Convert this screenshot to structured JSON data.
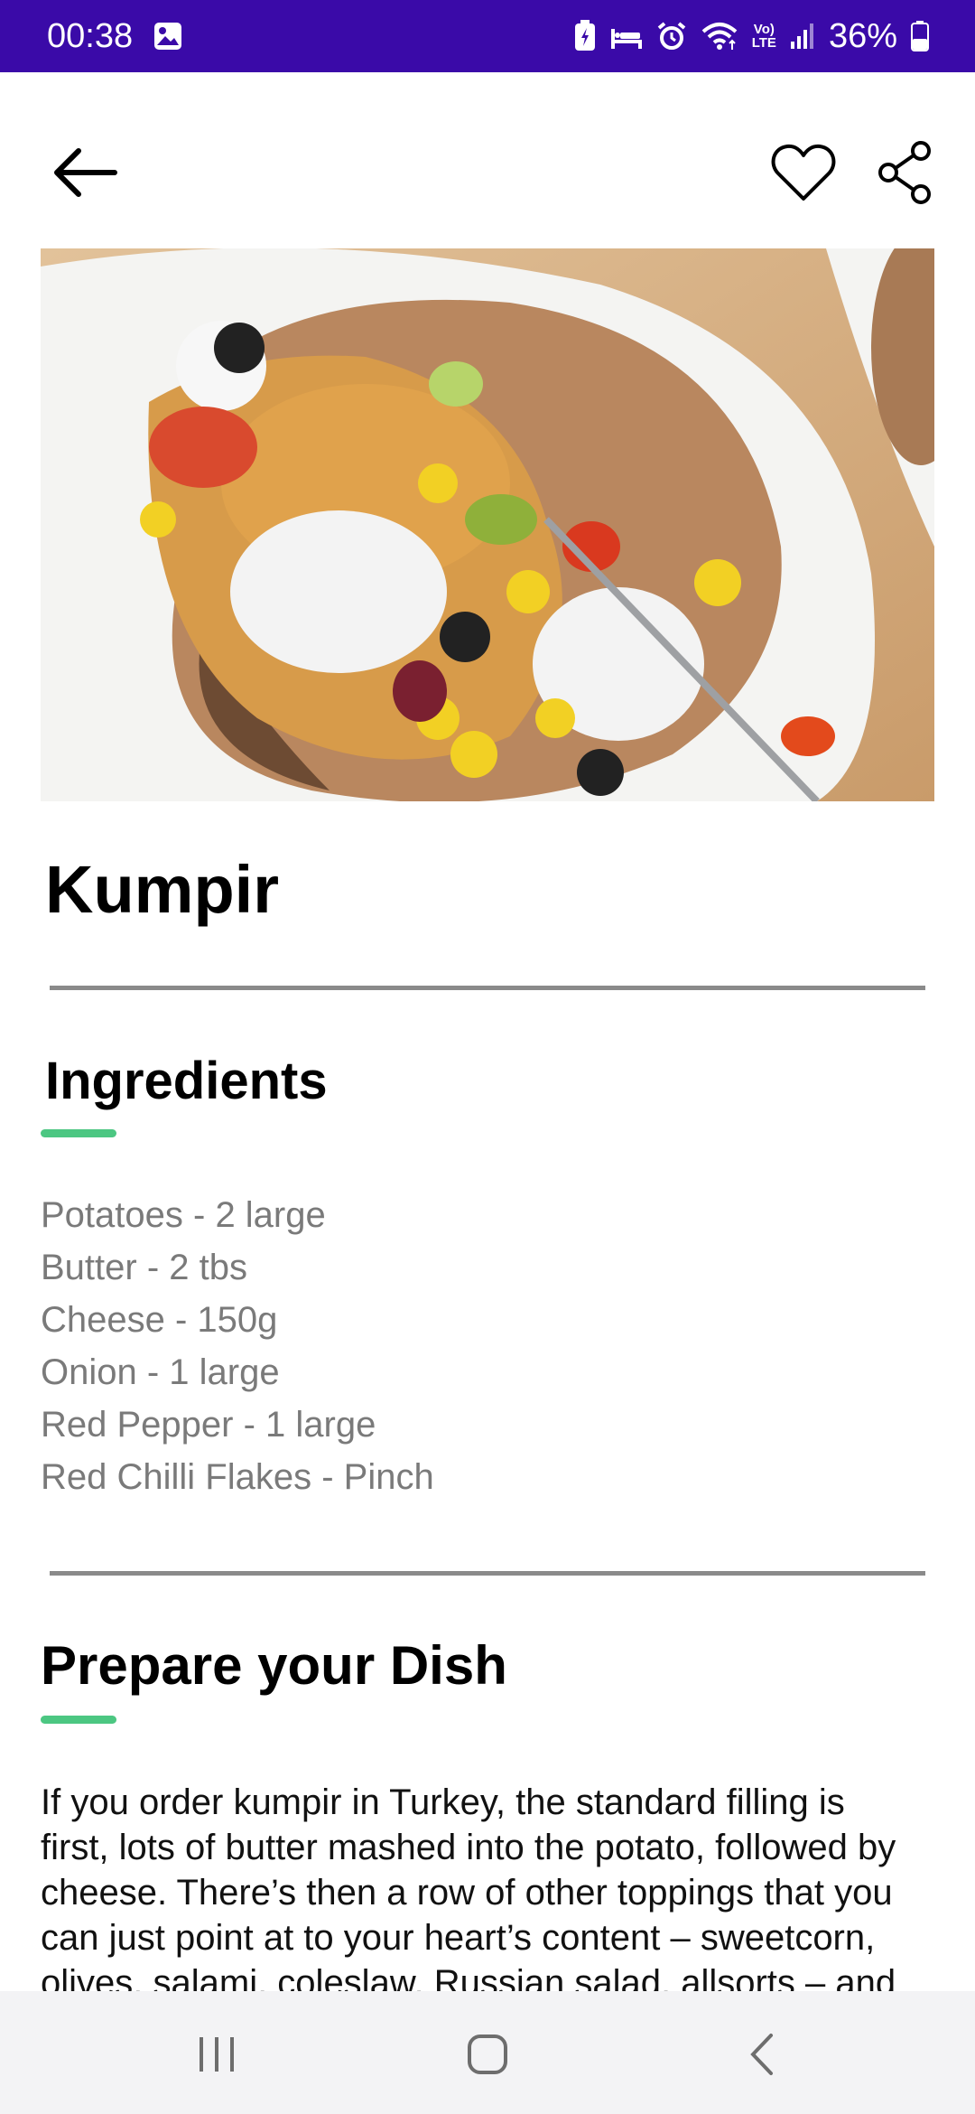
{
  "status_bar": {
    "time": "00:38",
    "battery": "36%",
    "icons": [
      "gallery-icon",
      "battery-saver-icon",
      "sleep-icon",
      "alarm-icon",
      "wifi-icon",
      "volte-icon",
      "signal-icon",
      "battery-icon"
    ],
    "volte_label_top": "Vo)",
    "volte_label_bottom": "LTE"
  },
  "app_bar": {
    "icons": [
      "back-arrow-icon",
      "heart-icon",
      "share-icon"
    ]
  },
  "recipe": {
    "title": "Kumpir"
  },
  "ingredients": {
    "heading": "Ingredients",
    "items": [
      "Potatoes - 2 large",
      "Butter - 2 tbs",
      "Cheese - 150g",
      "Onion - 1 large",
      "Red Pepper - 1 large",
      "Red Chilli Flakes - Pinch"
    ]
  },
  "prepare": {
    "heading": "Prepare your Dish",
    "lines": [
      "If you order kumpir in Turkey, the standard filling is",
      "first, lots of butter mashed into the potato, followed by",
      "cheese. There’s then a row of other toppings that you",
      "can just point at to your heart’s content – sweetcorn,",
      "olives, salami, coleslaw, Russian salad, allsorts – and"
    ]
  },
  "nav_bar": {
    "icons": [
      "recents-icon",
      "home-icon",
      "back-icon"
    ]
  },
  "colors": {
    "status_bar": "#3a0aa8",
    "accent": "#4cc782",
    "divider": "#8a8a8a",
    "ingredient_text": "#7a7a7a"
  }
}
